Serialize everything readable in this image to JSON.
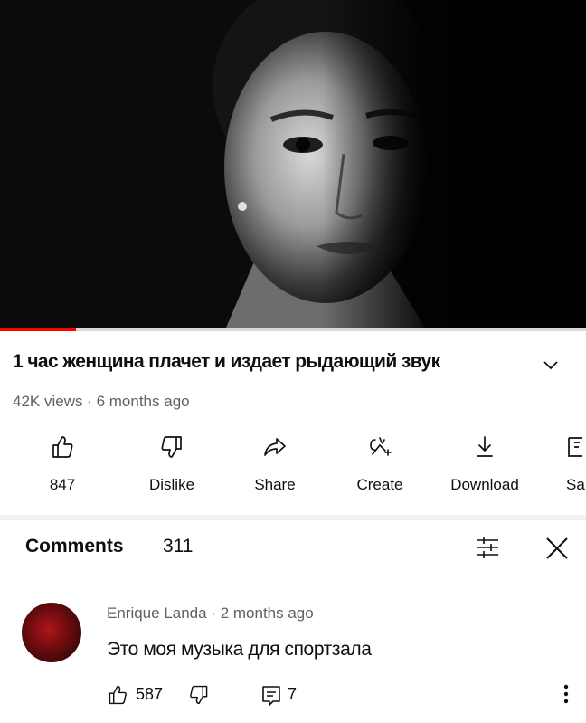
{
  "video": {
    "title": "1 час женщина плачет и издает рыдающий звук",
    "meta": "42K views · 6 months ago",
    "progress_fraction": 0.13,
    "accent_color": "#ff0000"
  },
  "actions": [
    {
      "label": "847",
      "icon": "thumbs-up-icon"
    },
    {
      "label": "Dislike",
      "icon": "thumbs-down-icon"
    },
    {
      "label": "Share",
      "icon": "share-icon"
    },
    {
      "label": "Create",
      "icon": "create-icon"
    },
    {
      "label": "Download",
      "icon": "download-icon"
    },
    {
      "label": "Sa",
      "icon": "save-icon"
    }
  ],
  "comments": {
    "heading": "Comments",
    "count": "311",
    "items": [
      {
        "author_meta": "Enrique Landa · 2 months ago",
        "text": "Это моя музыка для спортзала",
        "likes": "587",
        "replies": "7"
      }
    ]
  }
}
